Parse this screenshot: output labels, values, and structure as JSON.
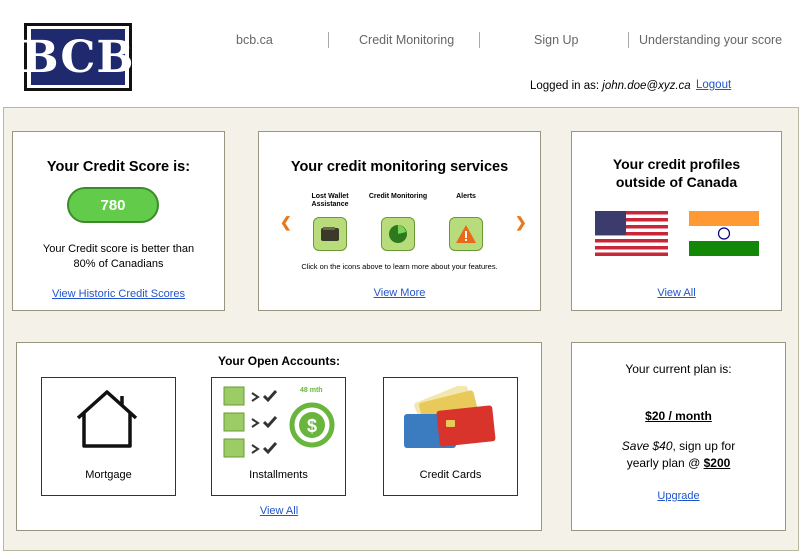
{
  "brand": {
    "logo_text": "BCB"
  },
  "nav": {
    "items": [
      "bcb.ca",
      "Credit Monitoring",
      "Sign Up",
      "Understanding your score"
    ]
  },
  "session": {
    "logged_in_label": "Logged in as:",
    "email": "john.doe@xyz.ca",
    "logout_label": "Logout"
  },
  "credit_score": {
    "title": "Your Credit Score is:",
    "score": "780",
    "comparison_line1": "Your Credit score is better than",
    "comparison_line2": "80% of Canadians",
    "history_link": "View Historic Credit Scores"
  },
  "monitoring": {
    "title": "Your credit monitoring services",
    "services": [
      {
        "label_line1": "Lost Wallet",
        "label_line2": "Assistance",
        "icon": "wallet-icon"
      },
      {
        "label_line1": "Credit Monitoring",
        "label_line2": "",
        "icon": "monitoring-icon"
      },
      {
        "label_line1": "Alerts",
        "label_line2": "",
        "icon": "alert-icon"
      }
    ],
    "hint": "Click on the icons above to learn more about your features.",
    "more_link": "View More"
  },
  "profiles": {
    "title_line1": "Your credit profiles",
    "title_line2": "outside of Canada",
    "countries": [
      {
        "flag": "usa-flag-icon"
      },
      {
        "flag": "india-flag-icon"
      }
    ],
    "view_all": "View All"
  },
  "accounts": {
    "title": "Your Open Accounts:",
    "items": [
      {
        "label": "Mortgage",
        "icon": "house-icon"
      },
      {
        "label": "Installments",
        "icon": "installments-icon",
        "badge": "48 mth"
      },
      {
        "label": "Credit Cards",
        "icon": "credit-cards-icon"
      }
    ],
    "view_all": "View All"
  },
  "plan": {
    "title": "Your current plan is:",
    "price": "$20 / month",
    "save_line1_prefix": "Save $40",
    "save_line1_suffix": ", sign up for",
    "save_line2_prefix": "yearly plan @ ",
    "yearly_price": "$200",
    "upgrade": "Upgrade"
  },
  "colors": {
    "brand_navy": "#1f2a6e",
    "score_green": "#62cc4a",
    "link_blue": "#2255cc",
    "arrow_orange": "#e8781a"
  }
}
